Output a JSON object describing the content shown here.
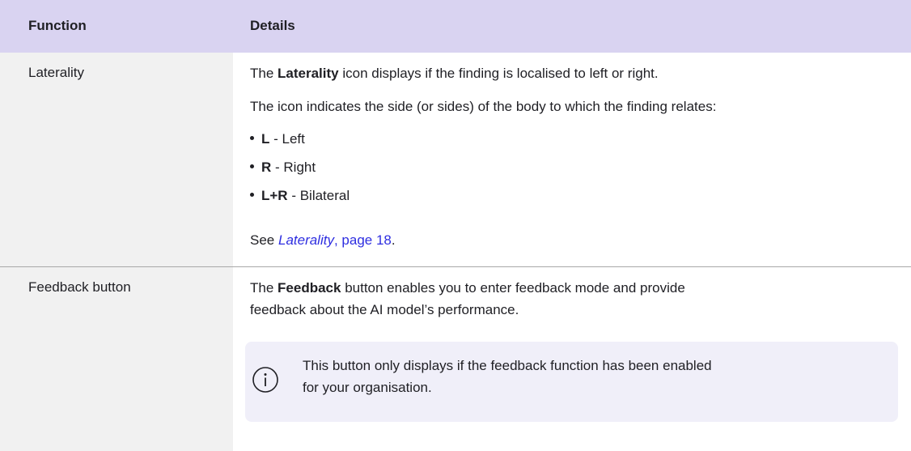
{
  "table": {
    "headers": {
      "function": "Function",
      "details": "Details"
    },
    "rows": [
      {
        "function": "Laterality",
        "intro_pre": "The ",
        "intro_bold": "Laterality",
        "intro_post": " icon displays if the finding is localised to left or right.",
        "description": "The icon indicates the side (or sides) of the body to which the finding relates:",
        "bullets": [
          {
            "code": "L",
            "text": " - Left"
          },
          {
            "code": "R",
            "text": " - Right"
          },
          {
            "code": "L+R",
            "text": " - Bilateral"
          }
        ],
        "see_also": {
          "prefix": "See ",
          "link_title": "Laterality",
          "link_page": ", page 18",
          "suffix": "."
        }
      },
      {
        "function": "Feedback button",
        "intro_pre": "The ",
        "intro_bold": "Feedback",
        "intro_post_line1": " button enables you to enter feedback mode and provide",
        "intro_line2": "feedback about the AI model’s performance.",
        "note": {
          "icon": "info-circle-icon",
          "line1": "This button only displays if the feedback function has been enabled",
          "line2": "for your organisation."
        }
      }
    ]
  },
  "colors": {
    "header_bg": "#d9d3f1",
    "function_col_bg": "#f1f1f1",
    "note_bg": "#f0eff9",
    "link": "#2e2ee0"
  }
}
